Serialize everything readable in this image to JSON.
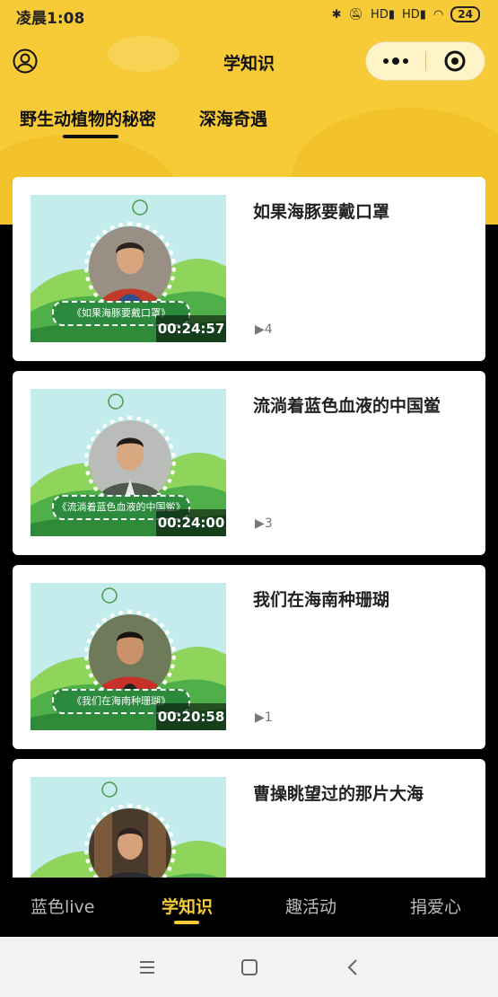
{
  "status_bar": {
    "time": "凌晨1:08",
    "battery": "24",
    "signal1": "HD",
    "signal2": "HD"
  },
  "navbar": {
    "title": "学知识",
    "more_label": "•••"
  },
  "tabs": [
    {
      "label": "野生动植物的秘密",
      "active": true
    },
    {
      "label": "深海奇遇",
      "active": false
    }
  ],
  "videos": [
    {
      "title": "如果海豚要戴口罩",
      "caption": "《如果海豚要戴口罩》",
      "duration": "00:24:57",
      "count": "4"
    },
    {
      "title": "流淌着蓝色血液的中国鲎",
      "caption": "《流淌着蓝色血液的中国鲎》",
      "duration": "00:24:00",
      "count": "3"
    },
    {
      "title": "我们在海南种珊瑚",
      "caption": "《我们在海南种珊瑚》",
      "duration": "00:20:58",
      "count": "1"
    },
    {
      "title": "曹操眺望过的那片大海",
      "caption": "",
      "duration": "",
      "count": ""
    }
  ],
  "tabbar": [
    {
      "label": "蓝色live",
      "active": false
    },
    {
      "label": "学知识",
      "active": true
    },
    {
      "label": "趣活动",
      "active": false
    },
    {
      "label": "捐爱心",
      "active": false
    }
  ],
  "colors": {
    "accent": "#f6cb37",
    "background": "#000000",
    "card": "#ffffff"
  }
}
